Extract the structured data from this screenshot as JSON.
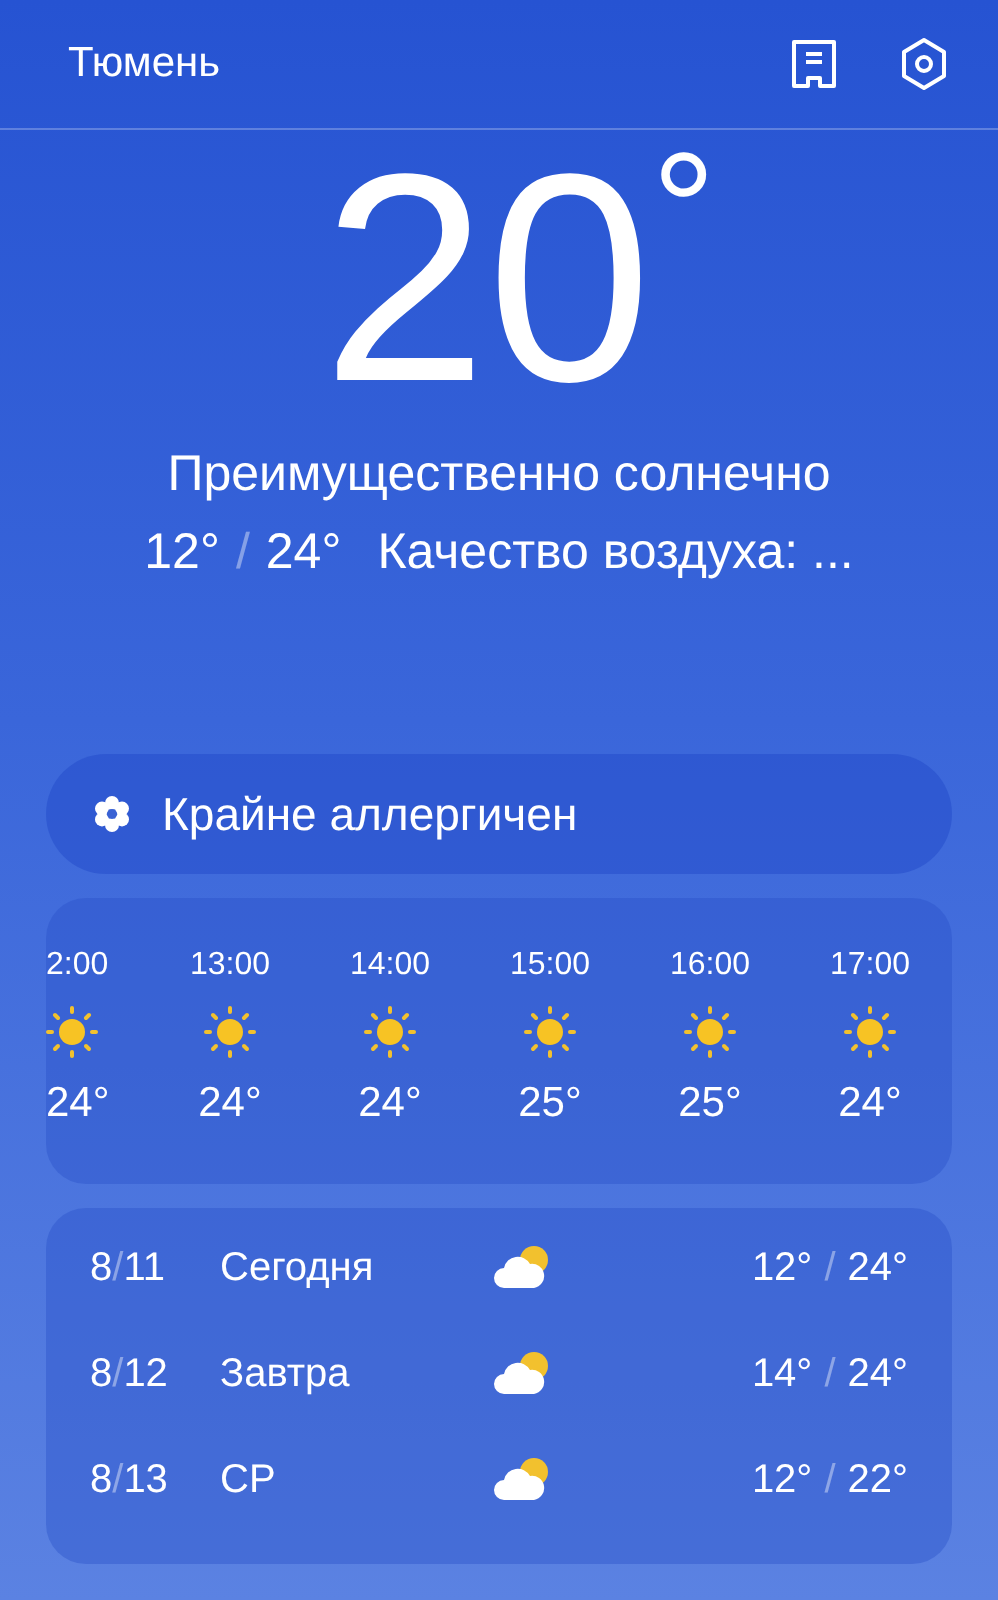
{
  "header": {
    "city": "Тюмень"
  },
  "current": {
    "temperature": "20",
    "degree": "°",
    "condition": "Преимущественно солнечно",
    "low": "12°",
    "separator": "/",
    "high": "24°",
    "air_quality": "Качество воздуха: ..."
  },
  "allergy": {
    "label": "Крайне аллергичен"
  },
  "hourly": [
    {
      "time": "2:00",
      "kind": "sun",
      "temp": "24°"
    },
    {
      "time": "13:00",
      "kind": "sun",
      "temp": "24°"
    },
    {
      "time": "14:00",
      "kind": "sun",
      "temp": "24°"
    },
    {
      "time": "15:00",
      "kind": "sun",
      "temp": "25°"
    },
    {
      "time": "16:00",
      "kind": "sun",
      "temp": "25°"
    },
    {
      "time": "17:00",
      "kind": "sun",
      "temp": "24°"
    }
  ],
  "daily": [
    {
      "month": "8",
      "sep": "/",
      "day": "11",
      "label": "Сегодня",
      "kind": "partly-cloudy",
      "low": "12°",
      "separator": "/",
      "high": "24°"
    },
    {
      "month": "8",
      "sep": "/",
      "day": "12",
      "label": "Завтра",
      "kind": "partly-cloudy",
      "low": "14°",
      "separator": "/",
      "high": "24°"
    },
    {
      "month": "8",
      "sep": "/",
      "day": "13",
      "label": "СР",
      "kind": "partly-cloudy",
      "low": "12°",
      "separator": "/",
      "high": "22°"
    }
  ]
}
